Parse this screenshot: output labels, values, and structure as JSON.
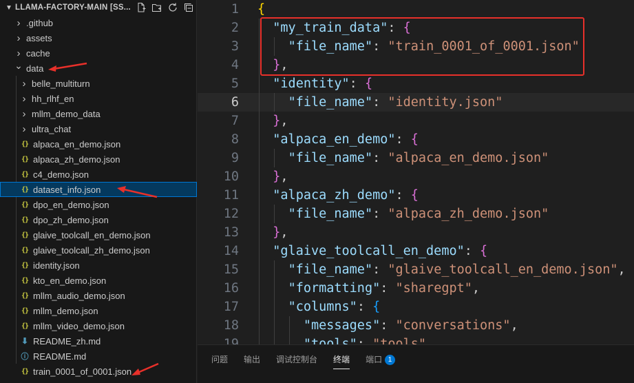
{
  "explorer": {
    "title": "LLAMA-FACTORY-MAIN [SS...",
    "actions": [
      "new-file-icon",
      "new-folder-icon",
      "refresh-icon",
      "collapse-all-icon"
    ],
    "items": [
      {
        "label": ".github",
        "kind": "folder",
        "expanded": false,
        "depth": 0
      },
      {
        "label": "assets",
        "kind": "folder",
        "expanded": false,
        "depth": 0
      },
      {
        "label": "cache",
        "kind": "folder",
        "expanded": false,
        "depth": 0
      },
      {
        "label": "data",
        "kind": "folder",
        "expanded": true,
        "depth": 0
      },
      {
        "label": "belle_multiturn",
        "kind": "folder",
        "expanded": false,
        "depth": 1
      },
      {
        "label": "hh_rlhf_en",
        "kind": "folder",
        "expanded": false,
        "depth": 1
      },
      {
        "label": "mllm_demo_data",
        "kind": "folder",
        "expanded": false,
        "depth": 1
      },
      {
        "label": "ultra_chat",
        "kind": "folder",
        "expanded": false,
        "depth": 1
      },
      {
        "label": "alpaca_en_demo.json",
        "kind": "json",
        "depth": 1
      },
      {
        "label": "alpaca_zh_demo.json",
        "kind": "json",
        "depth": 1
      },
      {
        "label": "c4_demo.json",
        "kind": "json",
        "depth": 1
      },
      {
        "label": "dataset_info.json",
        "kind": "json",
        "depth": 1,
        "selected": true
      },
      {
        "label": "dpo_en_demo.json",
        "kind": "json",
        "depth": 1
      },
      {
        "label": "dpo_zh_demo.json",
        "kind": "json",
        "depth": 1
      },
      {
        "label": "glaive_toolcall_en_demo.json",
        "kind": "json",
        "depth": 1
      },
      {
        "label": "glaive_toolcall_zh_demo.json",
        "kind": "json",
        "depth": 1
      },
      {
        "label": "identity.json",
        "kind": "json",
        "depth": 1
      },
      {
        "label": "kto_en_demo.json",
        "kind": "json",
        "depth": 1
      },
      {
        "label": "mllm_audio_demo.json",
        "kind": "json",
        "depth": 1
      },
      {
        "label": "mllm_demo.json",
        "kind": "json",
        "depth": 1
      },
      {
        "label": "mllm_video_demo.json",
        "kind": "json",
        "depth": 1
      },
      {
        "label": "README_zh.md",
        "kind": "md",
        "depth": 1
      },
      {
        "label": "README.md",
        "kind": "info",
        "depth": 1
      },
      {
        "label": "train_0001_of_0001.json",
        "kind": "json",
        "depth": 1
      }
    ]
  },
  "editor": {
    "active_line": 6,
    "lines": [
      {
        "n": "1",
        "tokens": [
          [
            "b1",
            "{"
          ]
        ]
      },
      {
        "n": "2",
        "tokens": [
          [
            "ws",
            "  "
          ],
          [
            "k",
            "\"my_train_data\""
          ],
          [
            "p",
            ": "
          ],
          [
            "b2",
            "{"
          ]
        ]
      },
      {
        "n": "3",
        "tokens": [
          [
            "ws",
            "    "
          ],
          [
            "k",
            "\"file_name\""
          ],
          [
            "p",
            ": "
          ],
          [
            "s",
            "\"train_0001_of_0001.json\""
          ]
        ]
      },
      {
        "n": "4",
        "tokens": [
          [
            "ws",
            "  "
          ],
          [
            "b2",
            "}"
          ],
          [
            "p",
            ","
          ]
        ]
      },
      {
        "n": "5",
        "tokens": [
          [
            "ws",
            "  "
          ],
          [
            "k",
            "\"identity\""
          ],
          [
            "p",
            ": "
          ],
          [
            "b2",
            "{"
          ]
        ]
      },
      {
        "n": "6",
        "tokens": [
          [
            "ws",
            "    "
          ],
          [
            "k",
            "\"file_name\""
          ],
          [
            "p",
            ": "
          ],
          [
            "s",
            "\"identity.json\""
          ]
        ]
      },
      {
        "n": "7",
        "tokens": [
          [
            "ws",
            "  "
          ],
          [
            "b2",
            "}"
          ],
          [
            "p",
            ","
          ]
        ]
      },
      {
        "n": "8",
        "tokens": [
          [
            "ws",
            "  "
          ],
          [
            "k",
            "\"alpaca_en_demo\""
          ],
          [
            "p",
            ": "
          ],
          [
            "b2",
            "{"
          ]
        ]
      },
      {
        "n": "9",
        "tokens": [
          [
            "ws",
            "    "
          ],
          [
            "k",
            "\"file_name\""
          ],
          [
            "p",
            ": "
          ],
          [
            "s",
            "\"alpaca_en_demo.json\""
          ]
        ]
      },
      {
        "n": "10",
        "tokens": [
          [
            "ws",
            "  "
          ],
          [
            "b2",
            "}"
          ],
          [
            "p",
            ","
          ]
        ]
      },
      {
        "n": "11",
        "tokens": [
          [
            "ws",
            "  "
          ],
          [
            "k",
            "\"alpaca_zh_demo\""
          ],
          [
            "p",
            ": "
          ],
          [
            "b2",
            "{"
          ]
        ]
      },
      {
        "n": "12",
        "tokens": [
          [
            "ws",
            "    "
          ],
          [
            "k",
            "\"file_name\""
          ],
          [
            "p",
            ": "
          ],
          [
            "s",
            "\"alpaca_zh_demo.json\""
          ]
        ]
      },
      {
        "n": "13",
        "tokens": [
          [
            "ws",
            "  "
          ],
          [
            "b2",
            "}"
          ],
          [
            "p",
            ","
          ]
        ]
      },
      {
        "n": "14",
        "tokens": [
          [
            "ws",
            "  "
          ],
          [
            "k",
            "\"glaive_toolcall_en_demo\""
          ],
          [
            "p",
            ": "
          ],
          [
            "b2",
            "{"
          ]
        ]
      },
      {
        "n": "15",
        "tokens": [
          [
            "ws",
            "    "
          ],
          [
            "k",
            "\"file_name\""
          ],
          [
            "p",
            ": "
          ],
          [
            "s",
            "\"glaive_toolcall_en_demo.json\""
          ],
          [
            "p",
            ","
          ]
        ]
      },
      {
        "n": "16",
        "tokens": [
          [
            "ws",
            "    "
          ],
          [
            "k",
            "\"formatting\""
          ],
          [
            "p",
            ": "
          ],
          [
            "s",
            "\"sharegpt\""
          ],
          [
            "p",
            ","
          ]
        ]
      },
      {
        "n": "17",
        "tokens": [
          [
            "ws",
            "    "
          ],
          [
            "k",
            "\"columns\""
          ],
          [
            "p",
            ": "
          ],
          [
            "b3",
            "{"
          ]
        ]
      },
      {
        "n": "18",
        "tokens": [
          [
            "ws",
            "      "
          ],
          [
            "k",
            "\"messages\""
          ],
          [
            "p",
            ": "
          ],
          [
            "s",
            "\"conversations\""
          ],
          [
            "p",
            ","
          ]
        ]
      },
      {
        "n": "19",
        "tokens": [
          [
            "ws",
            "      "
          ],
          [
            "k",
            "\"tools\""
          ],
          [
            "p",
            ": "
          ],
          [
            "s",
            "\"tools\""
          ]
        ]
      }
    ]
  },
  "panel": {
    "tabs": [
      {
        "label": "问题",
        "active": false
      },
      {
        "label": "输出",
        "active": false
      },
      {
        "label": "调试控制台",
        "active": false
      },
      {
        "label": "终端",
        "active": true
      },
      {
        "label": "端口",
        "active": false,
        "badge": "1"
      }
    ]
  },
  "colors": {
    "annotation": "#e8302a",
    "selection": "#04395e",
    "focus_border": "#0078d4",
    "json_icon": "#cbcb41"
  }
}
